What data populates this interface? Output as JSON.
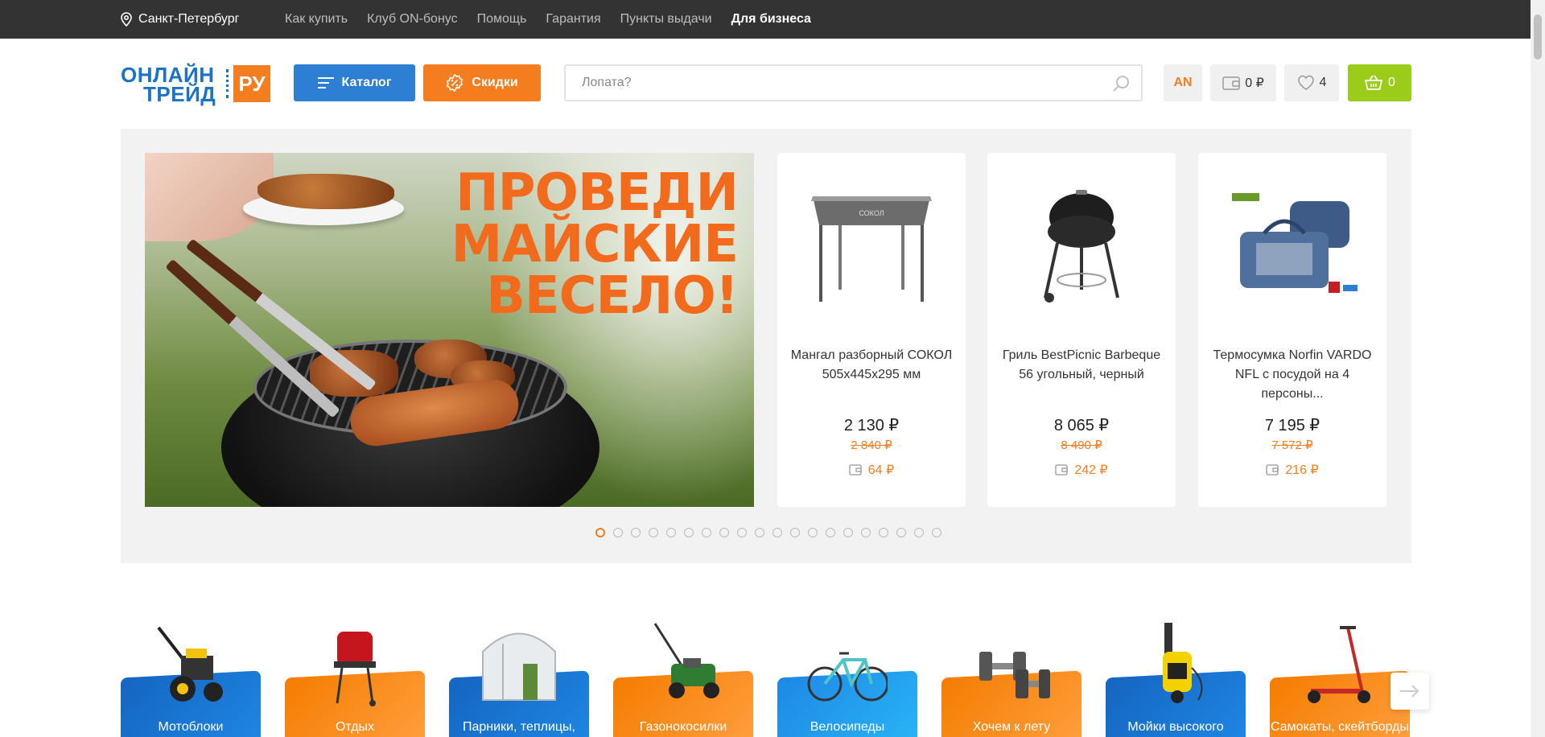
{
  "topbar": {
    "city": "Санкт-Петербург",
    "nav": [
      "Как купить",
      "Клуб ON-бонус",
      "Помощь",
      "Гарантия",
      "Пункты выдачи"
    ],
    "business": "Для бизнеса"
  },
  "header": {
    "logo_line1": "ОНЛАЙН",
    "logo_line2": "ТРЕЙД",
    "logo_ru": "РУ",
    "catalog_label": "Каталог",
    "sale_label": "Скидки",
    "search_placeholder": "Лопата?",
    "user_initials": "AN",
    "bonus_balance": "0 ₽",
    "favorites_count": "4",
    "cart_count": "0"
  },
  "banner": {
    "line1": "ПРОВЕДИ",
    "line2": "МАЙСКИЕ",
    "line3": "ВЕСЕЛО!"
  },
  "products": [
    {
      "name": "Мангал разборный СОКОЛ 505x445x295 мм",
      "price": "2 130 ₽",
      "old_price": "2 840 ₽",
      "bonus": "64 ₽",
      "icon": "brazier-image"
    },
    {
      "name": "Гриль BestPicnic Barbeque 56 угольный, черный",
      "price": "8 065 ₽",
      "old_price": "8 490 ₽",
      "bonus": "242 ₽",
      "icon": "kettle-grill-image"
    },
    {
      "name": "Термосумка Norfin VARDO NFL с посудой на 4 персоны...",
      "price": "7 195 ₽",
      "old_price": "7 572 ₽",
      "bonus": "216 ₽",
      "icon": "picnic-bag-image"
    }
  ],
  "slider": {
    "total": 20,
    "active": 0
  },
  "categories": [
    {
      "label": "Мотоблоки",
      "color": "blue"
    },
    {
      "label": "Отдых",
      "color": "orange"
    },
    {
      "label": "Парники, теплицы, укрывной материал",
      "color": "blue"
    },
    {
      "label": "Газонокосилки",
      "color": "orange"
    },
    {
      "label": "Велосипеды",
      "color": "sky"
    },
    {
      "label": "Хочем к лету",
      "color": "orange"
    },
    {
      "label": "Мойки высокого давления",
      "color": "blue"
    },
    {
      "label": "Самокаты, скейтборды",
      "color": "orange"
    }
  ],
  "colors": {
    "accent": "#f47d20",
    "brand_blue": "#2d7fd3",
    "cart_green": "#9ccc1a",
    "topbar": "#333333"
  }
}
